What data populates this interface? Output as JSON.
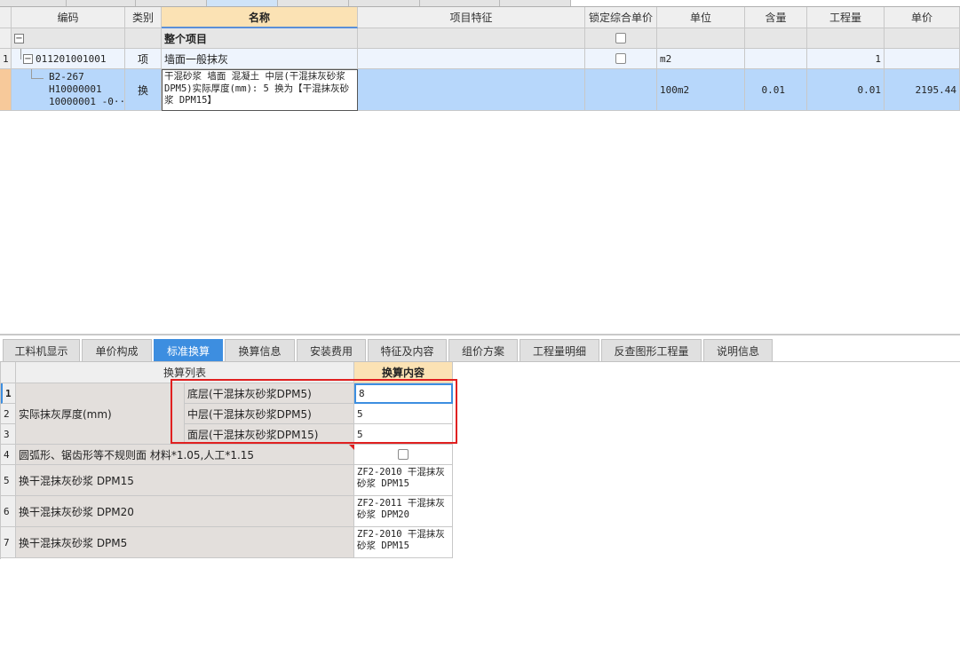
{
  "top_grid": {
    "headers": {
      "code": "编码",
      "type": "类别",
      "name": "名称",
      "feature": "项目特征",
      "lock": "锁定综合单价",
      "unit": "单位",
      "content": "含量",
      "quantity": "工程量",
      "price": "单价"
    },
    "rows": [
      {
        "index": "",
        "tree": "−",
        "code": "",
        "type": "",
        "name": "整个项目"
      },
      {
        "index": "1",
        "tree": "−",
        "code": "011201001001",
        "type": "项",
        "name": "墙面一般抹灰",
        "unit": "m2",
        "quantity": "1"
      },
      {
        "index": "",
        "code_lines": [
          "B2-267",
          "H10000001",
          "10000001 -0···"
        ],
        "type": "换",
        "name": "干混砂浆 墙面 混凝土  中层(干混抹灰砂浆DPM5)实际厚度(mm): 5  换为【干混抹灰砂浆 DPM15】",
        "unit": "100m2",
        "content": "0.01",
        "quantity": "0.01",
        "price": "2195.44"
      }
    ]
  },
  "bottom_tabs": [
    {
      "label": "工料机显示",
      "active": false
    },
    {
      "label": "单价构成",
      "active": false
    },
    {
      "label": "标准换算",
      "active": true
    },
    {
      "label": "换算信息",
      "active": false
    },
    {
      "label": "安装费用",
      "active": false
    },
    {
      "label": "特征及内容",
      "active": false
    },
    {
      "label": "组价方案",
      "active": false
    },
    {
      "label": "工程量明细",
      "active": false
    },
    {
      "label": "反查图形工程量",
      "active": false
    },
    {
      "label": "说明信息",
      "active": false
    }
  ],
  "conversion": {
    "headers": {
      "list": "换算列表",
      "content": "换算内容"
    },
    "thickness_label": "实际抹灰厚度(mm)",
    "thickness_rows": [
      {
        "index": "1",
        "label": "底层(干混抹灰砂浆DPM5)",
        "value": "8"
      },
      {
        "index": "2",
        "label": "中层(干混抹灰砂浆DPM5)",
        "value": "5"
      },
      {
        "index": "3",
        "label": "面层(干混抹灰砂浆DPM15)",
        "value": "5"
      }
    ],
    "row4": {
      "index": "4",
      "label": "圆弧形、锯齿形等不规则面 材料*1.05,人工*1.15"
    },
    "replace_rows": [
      {
        "index": "5",
        "label": "换干混抹灰砂浆 DPM15",
        "value": "ZF2-2010  干混抹灰砂浆 DPM15"
      },
      {
        "index": "6",
        "label": "换干混抹灰砂浆 DPM20",
        "value": "ZF2-2011  干混抹灰砂浆 DPM20"
      },
      {
        "index": "7",
        "label": "换干混抹灰砂浆 DPM5",
        "value": "ZF2-2010  干混抹灰砂浆 DPM15"
      }
    ]
  },
  "colors": {
    "selected_row": "#b7d7fb",
    "name_header": "#fbe2b4",
    "active_tab": "#3d8ee0",
    "highlight_border": "#e02020"
  }
}
